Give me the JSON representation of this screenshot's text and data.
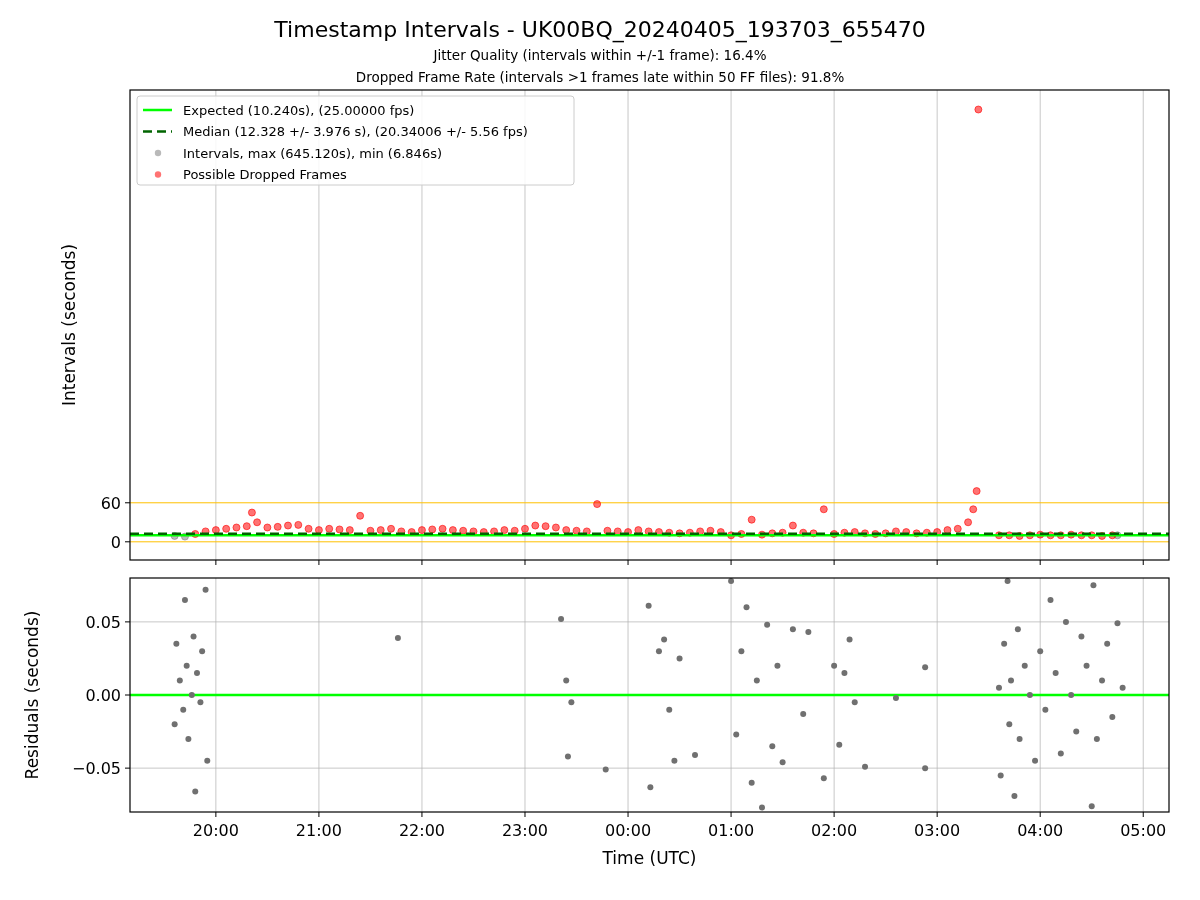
{
  "title": "Timestamp Intervals - UK00BQ_20240405_193703_655470",
  "subtitles": [
    "Jitter Quality (intervals within +/-1 frame): 16.4%",
    "Dropped Frame Rate (intervals >1 frames late within 50 FF files): 91.8%"
  ],
  "intervals_chart": {
    "chart_data": {
      "type": "scatter",
      "ylabel": "Intervals (seconds)",
      "grid": true,
      "xlim": [
        "2024-04-05T19:10",
        "2024-04-06T05:15"
      ],
      "ylim": [
        -28,
        695
      ],
      "yticks": [
        {
          "value": 0,
          "label": "0"
        },
        {
          "value": 60,
          "label": "60"
        }
      ],
      "legend": "upper left",
      "ref_lines": [
        {
          "axis": "y",
          "value": 10.24,
          "color": "#00ff00",
          "label": "Expected (10.240s), (25.00000 fps)"
        },
        {
          "axis": "y",
          "value": 12.328,
          "color": "#006400",
          "label": "Median (12.328 +/- 3.976 s), (20.34006 +/- 5.56 fps)"
        },
        {
          "axis": "y",
          "value": 60,
          "color": "#ffc000"
        },
        {
          "axis": "y",
          "value": 0,
          "color": "#ffc000"
        }
      ],
      "series": [
        {
          "name": "Intervals, max (645.120s), min (6.846s)",
          "color": "#808080",
          "x": [
            "2024-04-05T19:36",
            "2024-04-05T19:42",
            "2024-04-06T04:45"
          ],
          "values": [
            9,
            8,
            10
          ]
        },
        {
          "name": "Possible Dropped Frames",
          "color": "#ff0000",
          "x": [
            "2024-04-05T19:48",
            "2024-04-05T19:54",
            "2024-04-05T20:00",
            "2024-04-05T20:06",
            "2024-04-05T20:12",
            "2024-04-05T20:18",
            "2024-04-05T20:21",
            "2024-04-05T20:24",
            "2024-04-05T20:30",
            "2024-04-05T20:36",
            "2024-04-05T20:42",
            "2024-04-05T20:48",
            "2024-04-05T20:54",
            "2024-04-05T21:00",
            "2024-04-05T21:06",
            "2024-04-05T21:12",
            "2024-04-05T21:18",
            "2024-04-05T21:24",
            "2024-04-05T21:30",
            "2024-04-05T21:36",
            "2024-04-05T21:42",
            "2024-04-05T21:48",
            "2024-04-05T21:54",
            "2024-04-05T22:00",
            "2024-04-05T22:06",
            "2024-04-05T22:12",
            "2024-04-05T22:18",
            "2024-04-05T22:24",
            "2024-04-05T22:30",
            "2024-04-05T22:36",
            "2024-04-05T22:42",
            "2024-04-05T22:48",
            "2024-04-05T22:54",
            "2024-04-05T23:00",
            "2024-04-05T23:06",
            "2024-04-05T23:12",
            "2024-04-05T23:18",
            "2024-04-05T23:24",
            "2024-04-05T23:30",
            "2024-04-05T23:36",
            "2024-04-05T23:42",
            "2024-04-05T23:48",
            "2024-04-05T23:54",
            "2024-04-06T00:00",
            "2024-04-06T00:06",
            "2024-04-06T00:12",
            "2024-04-06T00:18",
            "2024-04-06T00:24",
            "2024-04-06T00:30",
            "2024-04-06T00:36",
            "2024-04-06T00:42",
            "2024-04-06T00:48",
            "2024-04-06T00:54",
            "2024-04-06T01:00",
            "2024-04-06T01:06",
            "2024-04-06T01:12",
            "2024-04-06T01:18",
            "2024-04-06T01:24",
            "2024-04-06T01:30",
            "2024-04-06T01:36",
            "2024-04-06T01:42",
            "2024-04-06T01:48",
            "2024-04-06T01:54",
            "2024-04-06T02:00",
            "2024-04-06T02:06",
            "2024-04-06T02:12",
            "2024-04-06T02:18",
            "2024-04-06T02:24",
            "2024-04-06T02:30",
            "2024-04-06T02:36",
            "2024-04-06T02:42",
            "2024-04-06T02:48",
            "2024-04-06T02:54",
            "2024-04-06T03:00",
            "2024-04-06T03:06",
            "2024-04-06T03:12",
            "2024-04-06T03:18",
            "2024-04-06T03:21",
            "2024-04-06T03:23",
            "2024-04-06T03:24",
            "2024-04-06T03:36",
            "2024-04-06T03:42",
            "2024-04-06T03:48",
            "2024-04-06T03:54",
            "2024-04-06T04:00",
            "2024-04-06T04:06",
            "2024-04-06T04:12",
            "2024-04-06T04:18",
            "2024-04-06T04:24",
            "2024-04-06T04:30",
            "2024-04-06T04:36",
            "2024-04-06T04:42"
          ],
          "values": [
            12,
            16,
            18,
            20,
            22,
            24,
            45,
            30,
            22,
            23,
            25,
            26,
            20,
            18,
            20,
            19,
            18,
            40,
            17,
            18,
            20,
            16,
            15,
            18,
            19,
            20,
            18,
            17,
            16,
            15,
            16,
            18,
            17,
            20,
            25,
            24,
            22,
            18,
            17,
            16,
            58,
            17,
            16,
            15,
            18,
            16,
            15,
            14,
            13,
            14,
            16,
            17,
            15,
            10,
            12,
            34,
            11,
            13,
            14,
            25,
            14,
            13,
            50,
            12,
            14,
            15,
            13,
            12,
            13,
            16,
            15,
            13,
            14,
            15,
            18,
            20,
            30,
            50,
            78,
            665,
            10,
            10,
            9,
            10,
            11,
            10,
            10,
            11,
            10,
            10,
            9,
            10
          ]
        }
      ]
    }
  },
  "residuals_chart": {
    "chart_data": {
      "type": "scatter",
      "xlabel": "Time (UTC)",
      "ylabel": "Residuals (seconds)",
      "grid": true,
      "xlim": [
        "2024-04-05T19:10",
        "2024-04-06T05:15"
      ],
      "ylim": [
        -0.08,
        0.08
      ],
      "xticks": [
        {
          "value": "2024-04-05T20:00",
          "label": "20:00"
        },
        {
          "value": "2024-04-05T21:00",
          "label": "21:00"
        },
        {
          "value": "2024-04-05T22:00",
          "label": "22:00"
        },
        {
          "value": "2024-04-05T23:00",
          "label": "23:00"
        },
        {
          "value": "2024-04-06T00:00",
          "label": "00:00"
        },
        {
          "value": "2024-04-06T01:00",
          "label": "01:00"
        },
        {
          "value": "2024-04-06T02:00",
          "label": "02:00"
        },
        {
          "value": "2024-04-06T03:00",
          "label": "03:00"
        },
        {
          "value": "2024-04-06T04:00",
          "label": "04:00"
        },
        {
          "value": "2024-04-06T05:00",
          "label": "05:00"
        }
      ],
      "yticks": [
        {
          "value": 0.05,
          "label": "0.05"
        },
        {
          "value": 0,
          "label": "0.00"
        },
        {
          "value": -0.05,
          "label": "−0.05"
        }
      ],
      "ref_lines": [
        {
          "axis": "y",
          "value": 0,
          "color": "#00ff00"
        }
      ],
      "series": [
        {
          "color": "#707070",
          "x": [
            "2024-04-05T19:36",
            "2024-04-05T19:37",
            "2024-04-05T19:39",
            "2024-04-05T19:41",
            "2024-04-05T19:42",
            "2024-04-05T19:43",
            "2024-04-05T19:44",
            "2024-04-05T19:46",
            "2024-04-05T19:47",
            "2024-04-05T19:48",
            "2024-04-05T19:49",
            "2024-04-05T19:51",
            "2024-04-05T19:52",
            "2024-04-05T19:54",
            "2024-04-05T19:55",
            "2024-04-05T21:46",
            "2024-04-05T23:21",
            "2024-04-05T23:24",
            "2024-04-05T23:25",
            "2024-04-05T23:27",
            "2024-04-05T23:47",
            "2024-04-06T00:12",
            "2024-04-06T00:13",
            "2024-04-06T00:18",
            "2024-04-06T00:21",
            "2024-04-06T00:24",
            "2024-04-06T00:27",
            "2024-04-06T00:30",
            "2024-04-06T00:39",
            "2024-04-06T01:00",
            "2024-04-06T01:03",
            "2024-04-06T01:06",
            "2024-04-06T01:09",
            "2024-04-06T01:12",
            "2024-04-06T01:15",
            "2024-04-06T01:18",
            "2024-04-06T01:21",
            "2024-04-06T01:24",
            "2024-04-06T01:27",
            "2024-04-06T01:30",
            "2024-04-06T01:36",
            "2024-04-06T01:42",
            "2024-04-06T01:45",
            "2024-04-06T01:54",
            "2024-04-06T02:00",
            "2024-04-06T02:03",
            "2024-04-06T02:06",
            "2024-04-06T02:09",
            "2024-04-06T02:12",
            "2024-04-06T02:18",
            "2024-04-06T02:36",
            "2024-04-06T02:53",
            "2024-04-06T02:53",
            "2024-04-06T03:36",
            "2024-04-06T03:37",
            "2024-04-06T03:39",
            "2024-04-06T03:41",
            "2024-04-06T03:42",
            "2024-04-06T03:43",
            "2024-04-06T03:45",
            "2024-04-06T03:47",
            "2024-04-06T03:48",
            "2024-04-06T03:51",
            "2024-04-06T03:54",
            "2024-04-06T03:57",
            "2024-04-06T04:00",
            "2024-04-06T04:03",
            "2024-04-06T04:06",
            "2024-04-06T04:09",
            "2024-04-06T04:12",
            "2024-04-06T04:15",
            "2024-04-06T04:18",
            "2024-04-06T04:21",
            "2024-04-06T04:24",
            "2024-04-06T04:27",
            "2024-04-06T04:30",
            "2024-04-06T04:31",
            "2024-04-06T04:33",
            "2024-04-06T04:36",
            "2024-04-06T04:39",
            "2024-04-06T04:42",
            "2024-04-06T04:45",
            "2024-04-06T04:48"
          ],
          "values": [
            -0.02,
            0.035,
            0.01,
            -0.01,
            0.065,
            0.02,
            -0.03,
            0.0,
            0.04,
            -0.066,
            0.015,
            -0.005,
            0.03,
            0.072,
            -0.045,
            0.039,
            0.052,
            0.01,
            -0.042,
            -0.005,
            -0.051,
            0.061,
            -0.063,
            0.03,
            0.038,
            -0.01,
            -0.045,
            0.025,
            -0.041,
            0.078,
            -0.027,
            0.03,
            0.06,
            -0.06,
            0.01,
            -0.077,
            0.048,
            -0.035,
            0.02,
            -0.046,
            0.045,
            -0.013,
            0.043,
            -0.057,
            0.02,
            -0.034,
            0.015,
            0.038,
            -0.005,
            -0.049,
            -0.002,
            -0.05,
            0.019,
            0.005,
            -0.055,
            0.035,
            0.078,
            -0.02,
            0.01,
            -0.069,
            0.045,
            -0.03,
            0.02,
            0.0,
            -0.045,
            0.03,
            -0.01,
            0.065,
            0.015,
            -0.04,
            0.05,
            0.0,
            -0.025,
            0.04,
            0.02,
            -0.076,
            0.075,
            -0.03,
            0.01,
            0.035,
            -0.015,
            0.049,
            0.005
          ]
        }
      ]
    }
  }
}
